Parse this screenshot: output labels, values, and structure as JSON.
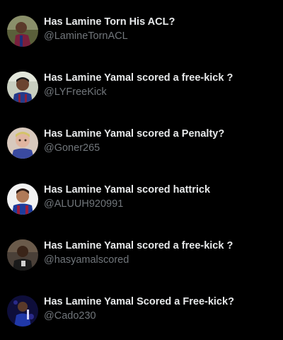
{
  "accounts": [
    {
      "name": "Has Lamine Torn His ACL?",
      "handle": "@LamineTornACL",
      "avatar": "player-photo-avatar"
    },
    {
      "name": "Has Lamine Yamal scored a free-kick ?",
      "handle": "@LYFreeKick",
      "avatar": "player-photo-avatar"
    },
    {
      "name": "Has Lamine Yamal scored a Penalty?",
      "handle": "@Goner265",
      "avatar": "player-photo-avatar"
    },
    {
      "name": "Has Lamine Yamal scored hattrick",
      "handle": "@ALUUH920991",
      "avatar": "player-photo-avatar"
    },
    {
      "name": "Has Lamine Yamal scored a free-kick ?",
      "handle": "@hasyamalscored",
      "avatar": "player-photo-avatar"
    },
    {
      "name": "Has Lamine Yamal Scored a Free-kick?",
      "handle": "@Cado230",
      "avatar": "player-photo-avatar"
    }
  ],
  "colors": {
    "background": "#000000",
    "name_text": "#e7e9ea",
    "handle_text": "#71767b"
  }
}
